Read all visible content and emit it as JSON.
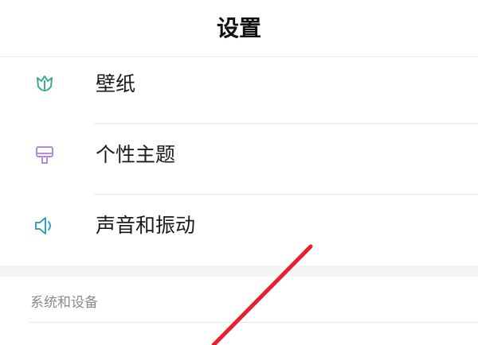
{
  "header": {
    "title": "设置"
  },
  "items": [
    {
      "label": "壁纸",
      "icon": "tulip-icon",
      "color": "#3fa89a"
    },
    {
      "label": "个性主题",
      "icon": "brush-icon",
      "color": "#b58ad6"
    },
    {
      "label": "声音和振动",
      "icon": "speaker-icon",
      "color": "#3a9fc0"
    }
  ],
  "section": {
    "title": "系统和设备"
  },
  "annotation": {
    "color": "#e8202e"
  }
}
